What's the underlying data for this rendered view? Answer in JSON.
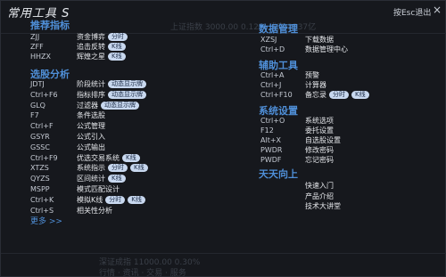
{
  "window": {
    "title": "常用工具 S",
    "esc_hint": "按Esc退出",
    "close_glyph": "×"
  },
  "background_ghost": {
    "line1": "上证指数  3000.00  0.12%  成交 2537亿",
    "line2": "深证成指  11000.00  0.30%",
    "line3": "行情 · 资讯 · 交易 · 服务"
  },
  "colors": {
    "accent": "#4f8fd8",
    "tag_bg": "#c8d8ef",
    "panel_bg": "#16181d"
  },
  "left": {
    "sec1": {
      "title": "推荐指标",
      "items": [
        {
          "key": "ZJJ",
          "desc": "资金博弈",
          "tags": [
            "分时"
          ]
        },
        {
          "key": "ZFF",
          "desc": "追击反转",
          "tags": [
            "K线"
          ]
        },
        {
          "key": "HHZX",
          "desc": "辉煌之星",
          "tags": [
            "K线"
          ]
        }
      ]
    },
    "sec2": {
      "title": "选股分析",
      "items": [
        {
          "key": "JDTJ",
          "desc": "阶段统计",
          "tags": [
            "动态显示牌"
          ]
        },
        {
          "key": "Ctrl+F6",
          "desc": "指标排序",
          "tags": [
            "动态显示牌"
          ]
        },
        {
          "key": "GLQ",
          "desc": "过滤器",
          "tags": [
            "动态显示牌"
          ]
        },
        {
          "key": "F7",
          "desc": "条件选股",
          "tags": []
        },
        {
          "key": "Ctrl+F",
          "desc": "公式管理",
          "tags": []
        },
        {
          "key": "GSYR",
          "desc": "公式引入",
          "tags": []
        },
        {
          "key": "GSSC",
          "desc": "公式输出",
          "tags": []
        },
        {
          "key": "Ctrl+F9",
          "desc": "优选交易系统",
          "tags": [
            "K线"
          ]
        },
        {
          "key": "XTZS",
          "desc": "系统指示",
          "tags": [
            "分时",
            "K线"
          ]
        },
        {
          "key": "QYZS",
          "desc": "区间统计",
          "tags": [
            "K线"
          ]
        },
        {
          "key": "MSPP",
          "desc": "模式匹配设计",
          "tags": []
        },
        {
          "key": "Ctrl+K",
          "desc": "模拟K线",
          "tags": [
            "分时",
            "K线"
          ]
        },
        {
          "key": "Ctrl+S",
          "desc": "相关性分析",
          "tags": []
        }
      ]
    },
    "more": "更多 >>"
  },
  "right": {
    "sec1": {
      "title": "数据管理",
      "items": [
        {
          "key": "XZSJ",
          "desc": "下载数据",
          "tags": []
        },
        {
          "key": "Ctrl+D",
          "desc": "数据管理中心",
          "tags": []
        }
      ]
    },
    "sec2": {
      "title": "辅助工具",
      "items": [
        {
          "key": "Ctrl+A",
          "desc": "预警",
          "tags": []
        },
        {
          "key": "Ctrl+J",
          "desc": "计算器",
          "tags": []
        },
        {
          "key": "Ctrl+F10",
          "desc": "备忘录",
          "tags": [
            "分时",
            "K线"
          ]
        }
      ]
    },
    "sec3": {
      "title": "系统设置",
      "items": [
        {
          "key": "Ctrl+O",
          "desc": "系统选项",
          "tags": []
        },
        {
          "key": "F12",
          "desc": "委托设置",
          "tags": []
        },
        {
          "key": "Alt+X",
          "desc": "自选股设置",
          "tags": []
        },
        {
          "key": "PWDR",
          "desc": "修改密码",
          "tags": []
        },
        {
          "key": "PWDF",
          "desc": "忘记密码",
          "tags": []
        }
      ]
    },
    "sec4": {
      "title": "天天向上",
      "items": [
        {
          "key": "",
          "desc": "快速入门",
          "tags": []
        },
        {
          "key": "",
          "desc": "产品介绍",
          "tags": []
        },
        {
          "key": "",
          "desc": "技术大讲堂",
          "tags": []
        }
      ]
    }
  }
}
